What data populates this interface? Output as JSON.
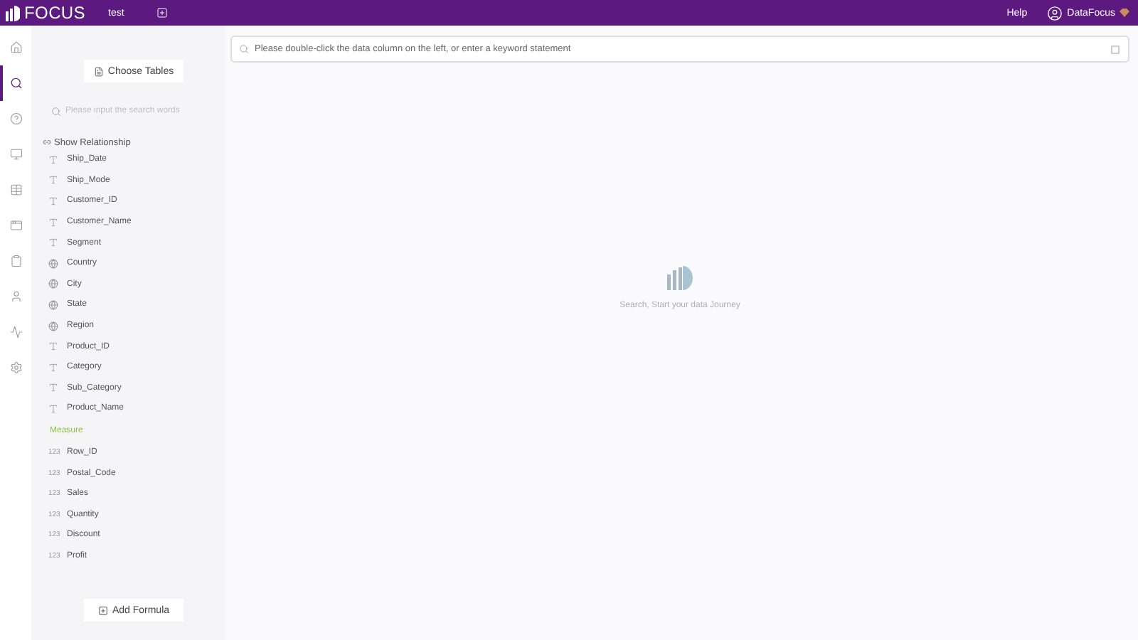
{
  "topbar": {
    "logo": "FOCUS",
    "tab": "test",
    "help": "Help",
    "user": "DataFocus"
  },
  "rail": [
    {
      "selected": false
    },
    {
      "selected": true
    },
    {
      "selected": false
    },
    {
      "selected": false
    },
    {
      "selected": false
    },
    {
      "selected": false
    },
    {
      "selected": false
    },
    {
      "selected": false
    },
    {
      "selected": false
    },
    {
      "selected": false
    }
  ],
  "sidebar": {
    "choose_tables": "Choose Tables",
    "search": {
      "placeholder": "Please input the search words"
    },
    "show_relationship": "Show Relationship",
    "fields": [
      {
        "kind": "text",
        "name": "Ship_Date"
      },
      {
        "kind": "text",
        "name": "Ship_Mode"
      },
      {
        "kind": "text",
        "name": "Customer_ID"
      },
      {
        "kind": "text",
        "name": "Customer_Name"
      },
      {
        "kind": "text",
        "name": "Segment"
      },
      {
        "kind": "geo",
        "name": "Country"
      },
      {
        "kind": "geo",
        "name": "City"
      },
      {
        "kind": "geo",
        "name": "State"
      },
      {
        "kind": "geo",
        "name": "Region"
      },
      {
        "kind": "text",
        "name": "Product_ID"
      },
      {
        "kind": "text",
        "name": "Category"
      },
      {
        "kind": "text",
        "name": "Sub_Category"
      },
      {
        "kind": "text",
        "name": "Product_Name"
      },
      {
        "kind": "heading",
        "name": "Measure"
      },
      {
        "kind": "number",
        "type_label": "123",
        "name": "Row_ID"
      },
      {
        "kind": "number",
        "type_label": "123",
        "name": "Postal_Code"
      },
      {
        "kind": "number",
        "type_label": "123",
        "name": "Sales"
      },
      {
        "kind": "number",
        "type_label": "123",
        "name": "Quantity"
      },
      {
        "kind": "number",
        "type_label": "123",
        "name": "Discount"
      },
      {
        "kind": "number",
        "type_label": "123",
        "name": "Profit"
      }
    ],
    "add_formula": "Add Formula"
  },
  "search_bar": {
    "placeholder": "Please double-click the data column on the left, or enter a keyword statement"
  },
  "empty_state": {
    "message": "Search, Start your data Journey"
  }
}
